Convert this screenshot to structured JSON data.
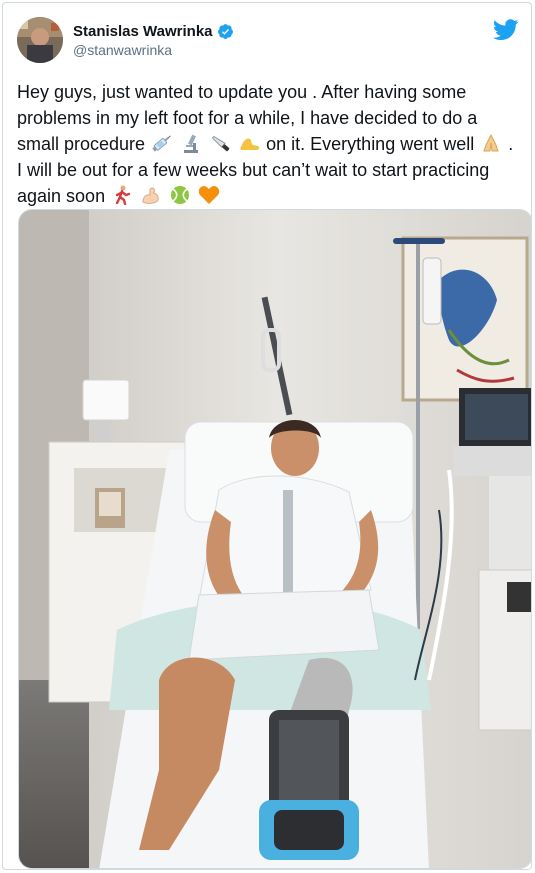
{
  "user": {
    "display_name": "Stanislas Wawrinka",
    "handle": "@stanwawrinka",
    "verified": true
  },
  "tweet": {
    "text_part1": "Hey guys, just wanted to update you . After having some problems in my left foot for a while, I have decided to do a small procedure",
    "text_part2": "on it. Everything went well",
    "text_part3": ". I will be out for a few weeks but can’t wait to start practicing again soon",
    "emojis_1": [
      "syringe-icon",
      "microscope-icon",
      "knife-icon",
      "foot-icon"
    ],
    "emojis_2": [
      "folded-hands-icon"
    ],
    "emojis_3": [
      "running-person-icon",
      "flexed-biceps-icon",
      "tennis-ball-icon",
      "orange-heart-icon"
    ]
  },
  "colors": {
    "twitter_blue": "#1da1f2",
    "handle_gray": "#5b7083",
    "border": "#cfd9de"
  },
  "media": {
    "type": "photo",
    "subject": "hospital-bed-recovery"
  }
}
